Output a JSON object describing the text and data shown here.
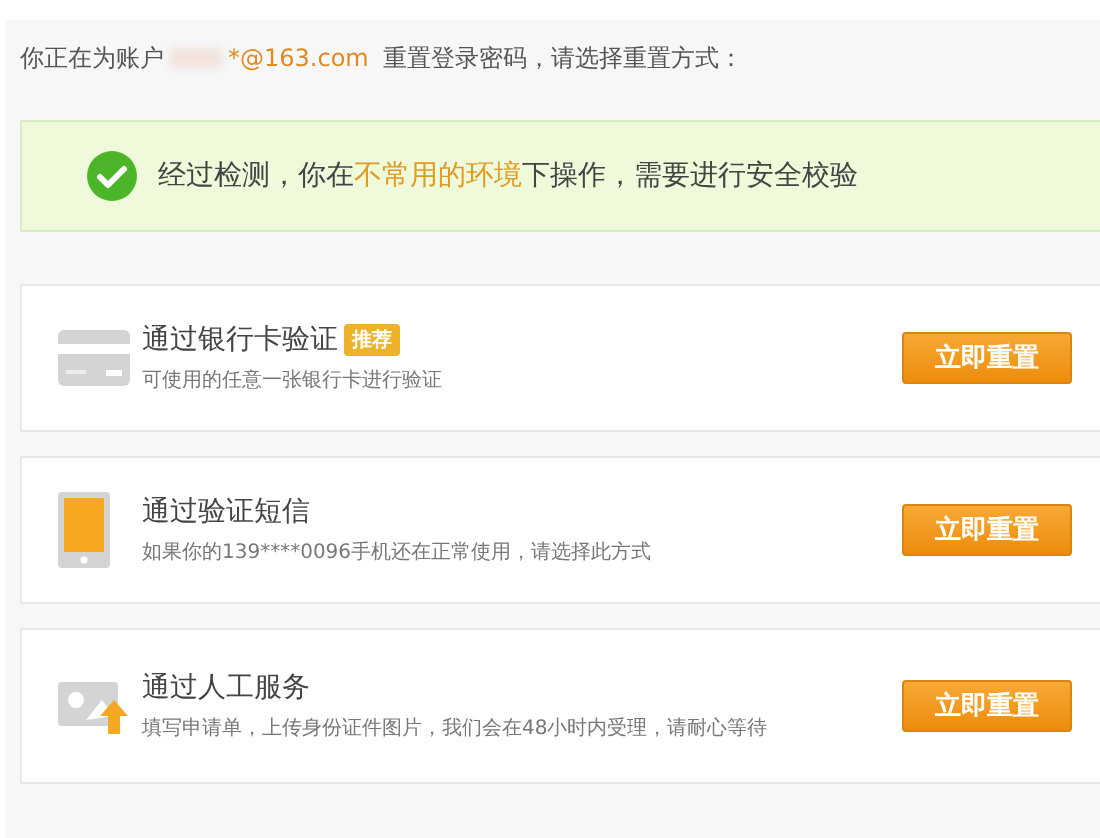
{
  "intro": {
    "before": "你正在为账户",
    "account": "*@163.com",
    "after": "重置登录密码，请选择重置方式："
  },
  "notice": {
    "before": "经过检测，你在",
    "highlight": "不常用的环境",
    "after": "下操作，需要进行安全校验"
  },
  "methods": [
    {
      "kind": "bank-card",
      "title": "通过银行卡验证",
      "badge": "推荐",
      "description": "可使用的任意一张银行卡进行验证",
      "button": "立即重置"
    },
    {
      "kind": "sms",
      "title": "通过验证短信",
      "description": "如果你的139****0096手机还在正常使用，请选择此方式",
      "button": "立即重置"
    },
    {
      "kind": "manual",
      "title": "通过人工服务",
      "description": "填写申请单，上传身份证件图片，我们会在48小时内受理，请耐心等待",
      "button": "立即重置"
    }
  ]
}
